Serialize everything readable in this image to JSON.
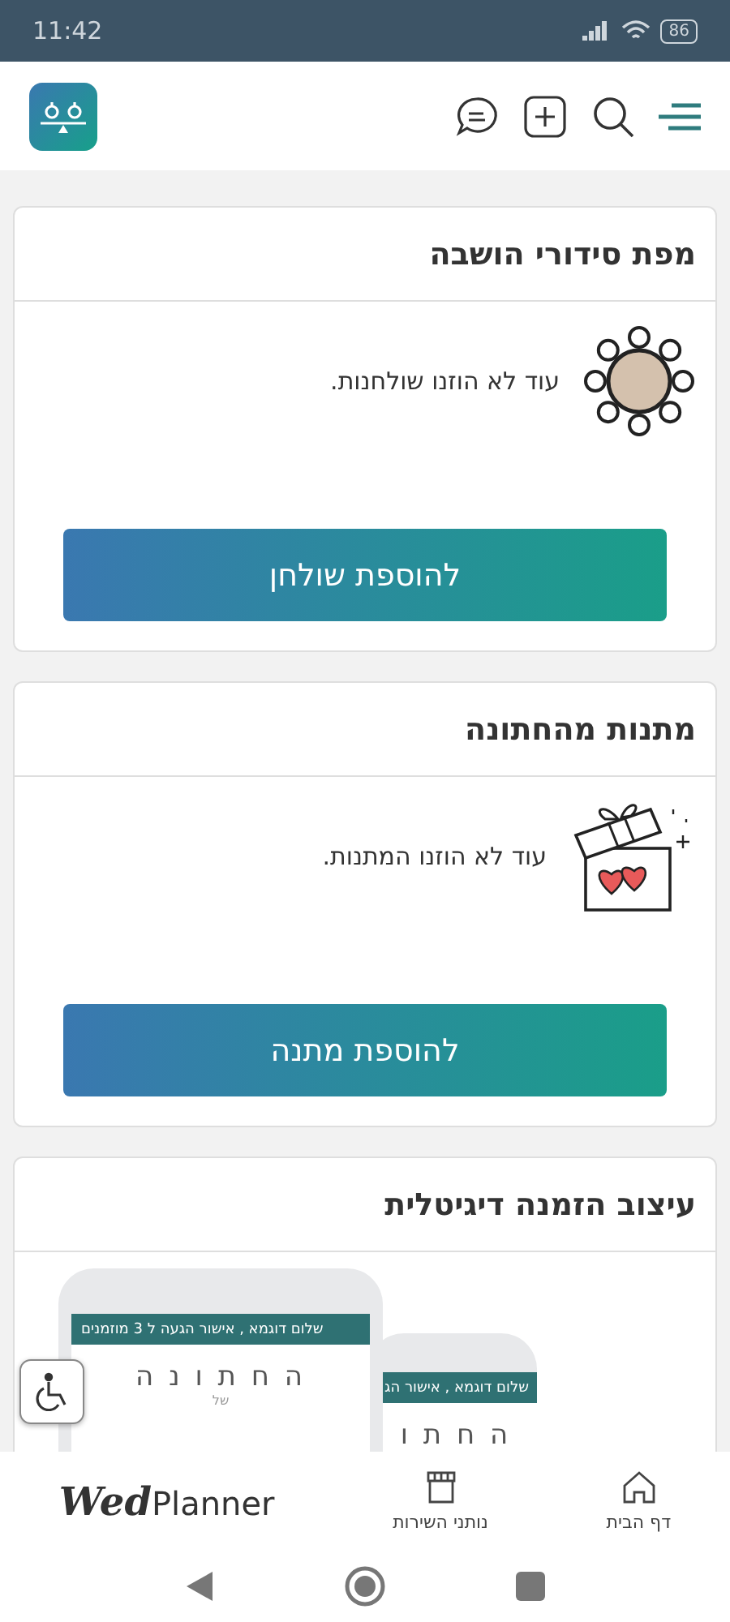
{
  "status_bar": {
    "time": "11:42",
    "battery": "86"
  },
  "sections": [
    {
      "kind": "seating",
      "title": "מפת סידורי הושבה",
      "empty_text": "עוד לא הוזנו שולחנות.",
      "button": "להוספת שולחן"
    },
    {
      "kind": "gifts",
      "title": "מתנות מהחתונה",
      "empty_text": "עוד לא הוזנו המתנות.",
      "button": "להוספת מתנה"
    },
    {
      "kind": "invitation",
      "title": "עיצוב הזמנה דיגיטלית",
      "previews": [
        {
          "header": "שלום דוגמא , אישור הג",
          "heading": "ה ח ת ו"
        },
        {
          "header": "שלום דוגמא , אישור הגעה ל 3 מוזמנים",
          "heading": "ה ח ת ו נ ה",
          "sub": "של"
        }
      ]
    }
  ],
  "bottom_nav": {
    "logo": {
      "script": "Wed",
      "plain": "Planner"
    },
    "items": [
      {
        "kind": "home",
        "label": "דף הבית"
      },
      {
        "kind": "vendors",
        "label": "נותני השירות"
      }
    ]
  }
}
